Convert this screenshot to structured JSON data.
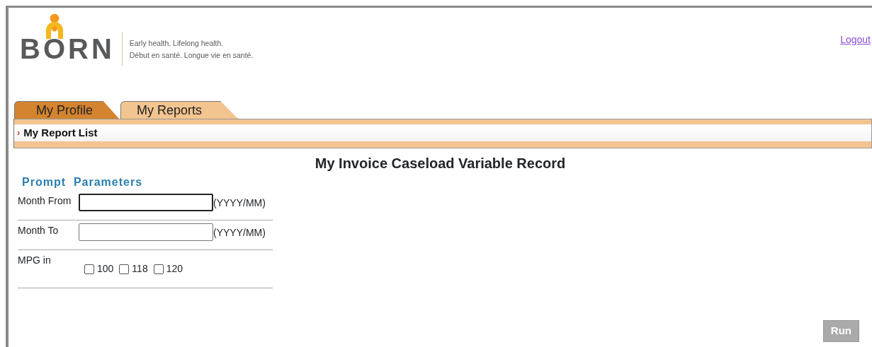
{
  "header": {
    "logo_text": "BORN",
    "tagline": [
      "Early health. Lifelong health.",
      "Début en santé. Longue vie en santé."
    ],
    "logout": "Logout"
  },
  "tabs": [
    {
      "label": "My Profile",
      "selected": false
    },
    {
      "label": "My Reports",
      "selected": true
    }
  ],
  "subnav": {
    "marker": "›",
    "label": "My Report List"
  },
  "title": "My Invoice Caseload Variable Record",
  "prompt_title": "Prompt  Parameters",
  "fields": [
    {
      "kind": "text",
      "label": "Month From",
      "hint": "(YYYY/MM)",
      "focused": true
    },
    {
      "kind": "text",
      "label": "Month To",
      "hint": "(YYYY/MM)",
      "focused": false
    },
    {
      "kind": "checks",
      "label": "MPG in",
      "options": [
        {
          "label": "100",
          "checked": false
        },
        {
          "label": "118",
          "checked": false
        },
        {
          "label": "120",
          "checked": false
        }
      ]
    }
  ],
  "run_button": {
    "label": "Run",
    "disabled": true
  }
}
